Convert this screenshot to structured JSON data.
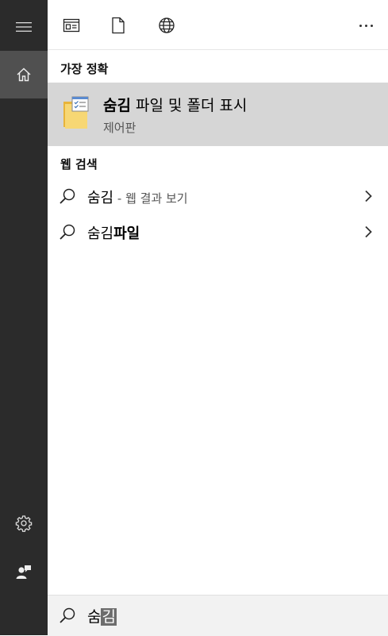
{
  "rail": {
    "items": [
      {
        "name": "menu",
        "icon": "hamburger-icon"
      },
      {
        "name": "home",
        "icon": "home-icon",
        "active": true
      },
      {
        "name": "settings",
        "icon": "gear-icon"
      },
      {
        "name": "account",
        "icon": "user-feedback-icon"
      }
    ]
  },
  "toolbar": {
    "icons": [
      "app-window-icon",
      "document-icon",
      "globe-icon",
      "more-icon"
    ]
  },
  "sections": {
    "best_match_title": "가장 정확",
    "web_search_title": "웹 검색"
  },
  "best_match": {
    "icon": "folder-options-icon",
    "title_bold": "숨김",
    "title_rest": " 파일 및 폴더 표시",
    "subtitle": "제어판"
  },
  "web_results": [
    {
      "query_plain": "숨김",
      "query_bold": "",
      "hint": " - 웹 결과 보기"
    },
    {
      "query_plain": "숨김",
      "query_bold": "파일",
      "hint": ""
    }
  ],
  "search": {
    "typed": "숨",
    "selected": "김"
  },
  "colors": {
    "rail_bg": "#2b2b2b",
    "rail_active": "#505050",
    "highlight_bg": "#d6d6d6",
    "searchbar_bg": "#f2f2f2"
  }
}
